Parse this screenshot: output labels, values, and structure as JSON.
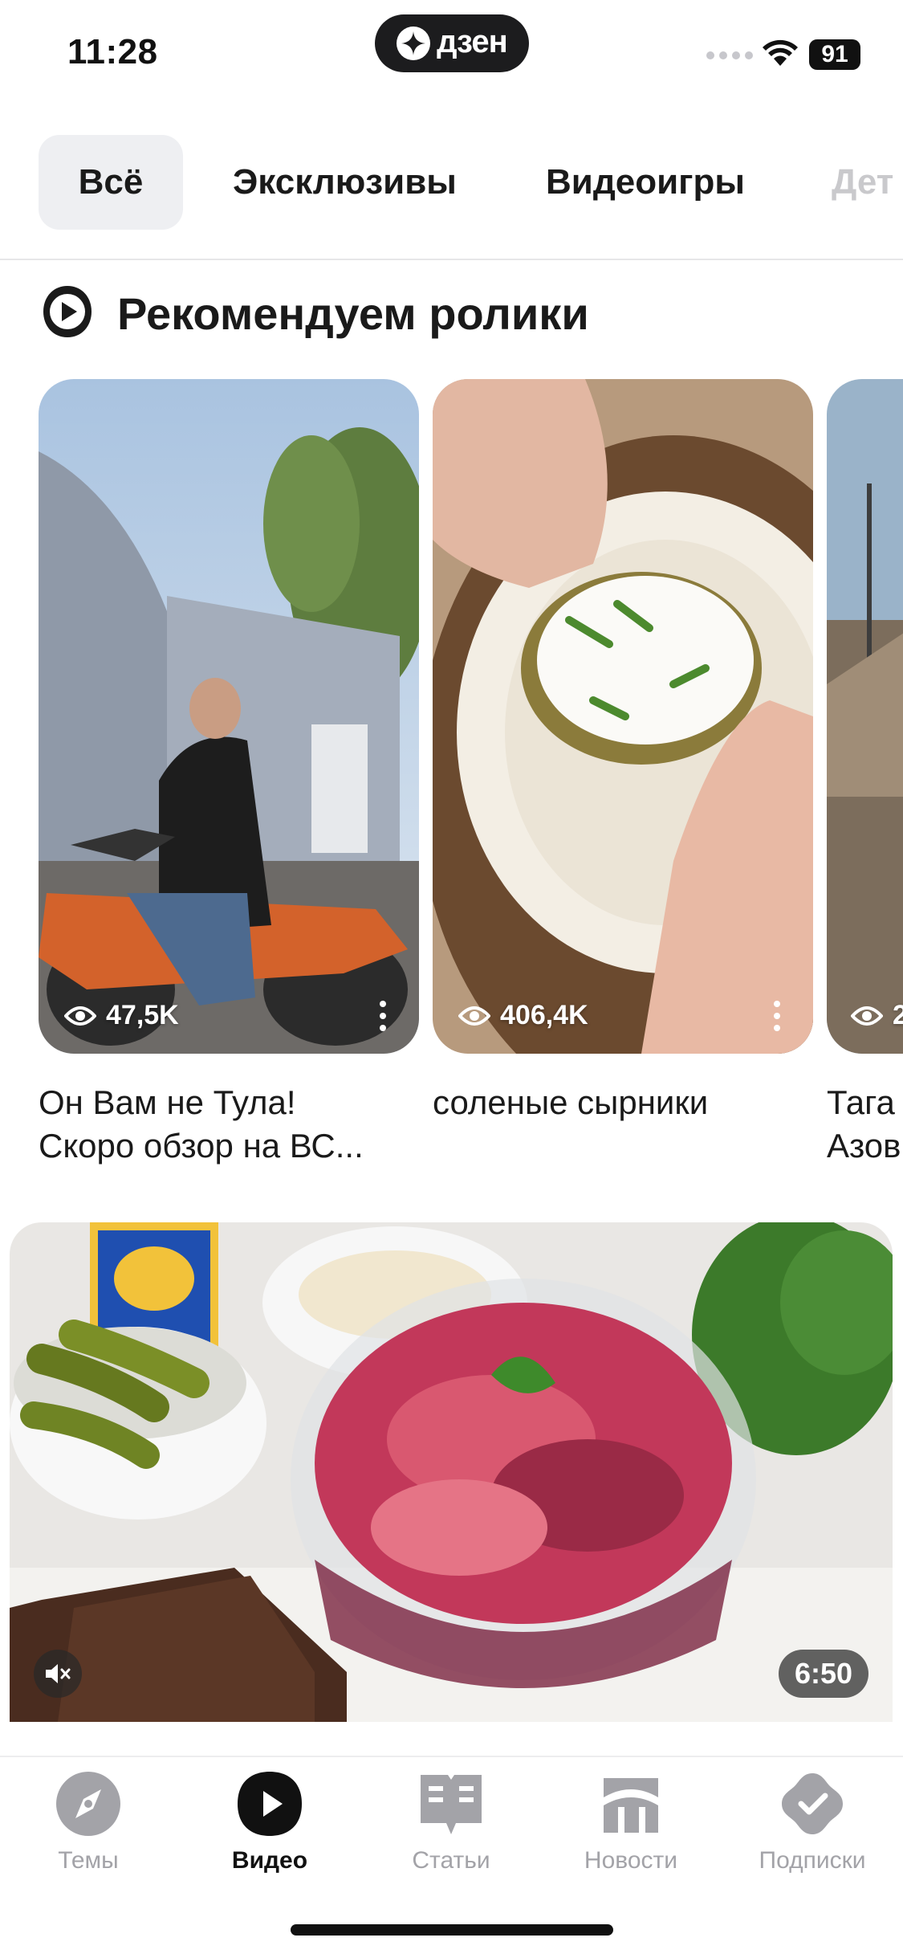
{
  "status_bar": {
    "time": "11:28",
    "brand": "дзен",
    "battery": "91"
  },
  "tabs": [
    {
      "label": "Всё",
      "active": true
    },
    {
      "label": "Эксклюзивы"
    },
    {
      "label": "Видеоигры"
    },
    {
      "label": "Дет"
    }
  ],
  "section": {
    "title": "Рекомендуем ролики",
    "icon": "play-circle-icon"
  },
  "shorts": [
    {
      "views": "47,5K",
      "title_line1": "Он Вам не Тула!",
      "title_line2": "Скоро обзор на ВС..."
    },
    {
      "views": "406,4K",
      "title_line1": "соленые сырники",
      "title_line2": ""
    },
    {
      "views": "2",
      "title_line1": "Тага",
      "title_line2": "Азов"
    }
  ],
  "video": {
    "duration": "6:50",
    "muted": true
  },
  "bottom_nav": [
    {
      "label": "Темы",
      "icon": "compass-icon",
      "active": false
    },
    {
      "label": "Видео",
      "icon": "video-icon",
      "active": true
    },
    {
      "label": "Статьи",
      "icon": "articles-icon",
      "active": false
    },
    {
      "label": "Новости",
      "icon": "news-icon",
      "active": false
    },
    {
      "label": "Подписки",
      "icon": "subscriptions-icon",
      "active": false
    }
  ],
  "colors": {
    "active_tab_bg": "#eeeff2",
    "nav_inactive": "#a3a3a8",
    "nav_active": "#111111"
  }
}
